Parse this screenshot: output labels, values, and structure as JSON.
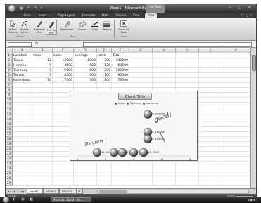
{
  "window": {
    "title": "Book1 - Microsoft Excel",
    "contextual_tab_group": "Ink Tools",
    "window_controls": [
      "─",
      "□",
      "✕"
    ]
  },
  "ribbon_tabs": [
    {
      "label": "Home",
      "active": false
    },
    {
      "label": "Insert",
      "active": false
    },
    {
      "label": "Page Layout",
      "active": false
    },
    {
      "label": "Formulas",
      "active": false
    },
    {
      "label": "Data",
      "active": false
    },
    {
      "label": "Review",
      "active": false
    },
    {
      "label": "View",
      "active": false
    },
    {
      "label": "Pens",
      "active": true
    }
  ],
  "ribbon": {
    "buttons": [
      {
        "label": "Select Objects",
        "icon": "pointer-icon"
      },
      {
        "label": "Delete All Ink",
        "icon": "eraser-ink-icon"
      },
      {
        "label": "Ballpoint Pen",
        "icon": "ballpoint-pen-icon"
      },
      {
        "label": "Felt Tip Pen",
        "icon": "felt-tip-pen-icon"
      },
      {
        "label": "Highlighter",
        "icon": "highlighter-icon"
      },
      {
        "label": "Eraser",
        "icon": "eraser-icon"
      },
      {
        "label": "Color",
        "icon": "color-icon"
      },
      {
        "label": "Weight",
        "icon": "weight-icon"
      },
      {
        "label": "Close Ink Tools",
        "icon": "close-icon"
      }
    ],
    "groups": [
      "Write",
      "Pens",
      "Close"
    ]
  },
  "formula_bar": {
    "name_box": "",
    "fx_label": "fx",
    "value": ""
  },
  "columns": [
    "A",
    "B",
    "C",
    "D",
    "E",
    "F",
    "G",
    "H",
    "I",
    "J",
    "K"
  ],
  "rows": [
    "1",
    "2",
    "3",
    "4",
    "5",
    "6",
    "7",
    "8",
    "9",
    "10",
    "11",
    "12",
    "13",
    "14",
    "15",
    "16",
    "17",
    "18",
    "19",
    "20",
    "21",
    "22",
    "23",
    "24",
    "25",
    "26",
    "27"
  ],
  "table": {
    "headers": [
      "Location",
      "shop",
      "sales",
      "average",
      "price",
      "Total"
    ],
    "rows": [
      [
        "Taipie",
        "12",
        "12000",
        "1000",
        "300",
        "300000"
      ],
      [
        "Hsinchu",
        "9",
        "4500",
        "500",
        "125",
        "62500"
      ],
      [
        "Taichung",
        "7",
        "5600",
        "800",
        "200",
        "160000"
      ],
      [
        "Tainan",
        "5",
        "4500",
        "900",
        "100",
        "90000"
      ],
      [
        "Kaohsiung",
        "10",
        "7000",
        "700",
        "100",
        "70000"
      ]
    ]
  },
  "chart_data": {
    "type": "scatter",
    "title": "Chart Title",
    "legend": [
      "Taipie",
      "Taichung",
      "Kaohsiung"
    ],
    "x_ticks": [
      "0",
      "2",
      "4",
      "6",
      "8"
    ],
    "points": [
      {
        "x": 5,
        "y": 300000,
        "label": "5, 300000"
      },
      {
        "x": 5,
        "y": 160000,
        "label": "5, 160000"
      },
      {
        "x": 5,
        "y": 105000,
        "label": "5, 105000"
      },
      {
        "x": 1.4,
        "y": 10,
        "label": "12, 10"
      },
      {
        "x": 2.6,
        "y": 10,
        "label": "9, 4500"
      },
      {
        "x": 3.2,
        "y": 10,
        "label": "7, 5600"
      },
      {
        "x": 4.0,
        "y": 10,
        "label": "5, 4500"
      },
      {
        "x": 4.7,
        "y": 10,
        "label": "10, 7000"
      }
    ],
    "ink_annotations": [
      "good!",
      "Review"
    ]
  },
  "sheets": [
    {
      "label": "Sheet1",
      "active": true
    },
    {
      "label": "Sheet2",
      "active": false
    },
    {
      "label": "Sheet3",
      "active": false
    }
  ],
  "status": {
    "ready": "Ready",
    "zoom": "100%"
  },
  "taskbar": {
    "task": "Microsoft Excel - Bo..."
  }
}
